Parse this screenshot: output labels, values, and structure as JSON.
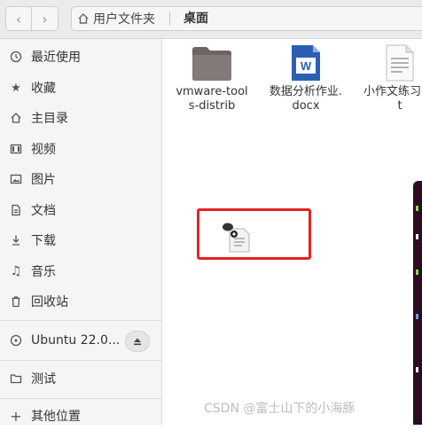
{
  "header": {
    "home_label": "用户文件夹",
    "current_folder": "桌面"
  },
  "sidebar": {
    "items": [
      {
        "label": "最近使用"
      },
      {
        "label": "收藏"
      },
      {
        "label": "主目录"
      },
      {
        "label": "视频"
      },
      {
        "label": "图片"
      },
      {
        "label": "文档"
      },
      {
        "label": "下载"
      },
      {
        "label": "音乐"
      },
      {
        "label": "回收站"
      }
    ],
    "device": {
      "label": "Ubuntu 22.0..."
    },
    "bookmark": {
      "label": "测试"
    },
    "other": {
      "label": "其他位置"
    }
  },
  "files": [
    {
      "name": "vmware-tools-distrib",
      "icon": "folder-icon"
    },
    {
      "name": "数据分析作业.docx",
      "icon": "word-document-icon"
    },
    {
      "name": "小作文练习.txt",
      "icon": "text-file-icon"
    }
  ],
  "watermark": "CSDN @富士山下的小海豚",
  "colors": {
    "selection_border": "#e22323",
    "folder": "#7a6f6f",
    "word_blue": "#2b5fb4",
    "terminal_bg": "#2d0b22"
  }
}
